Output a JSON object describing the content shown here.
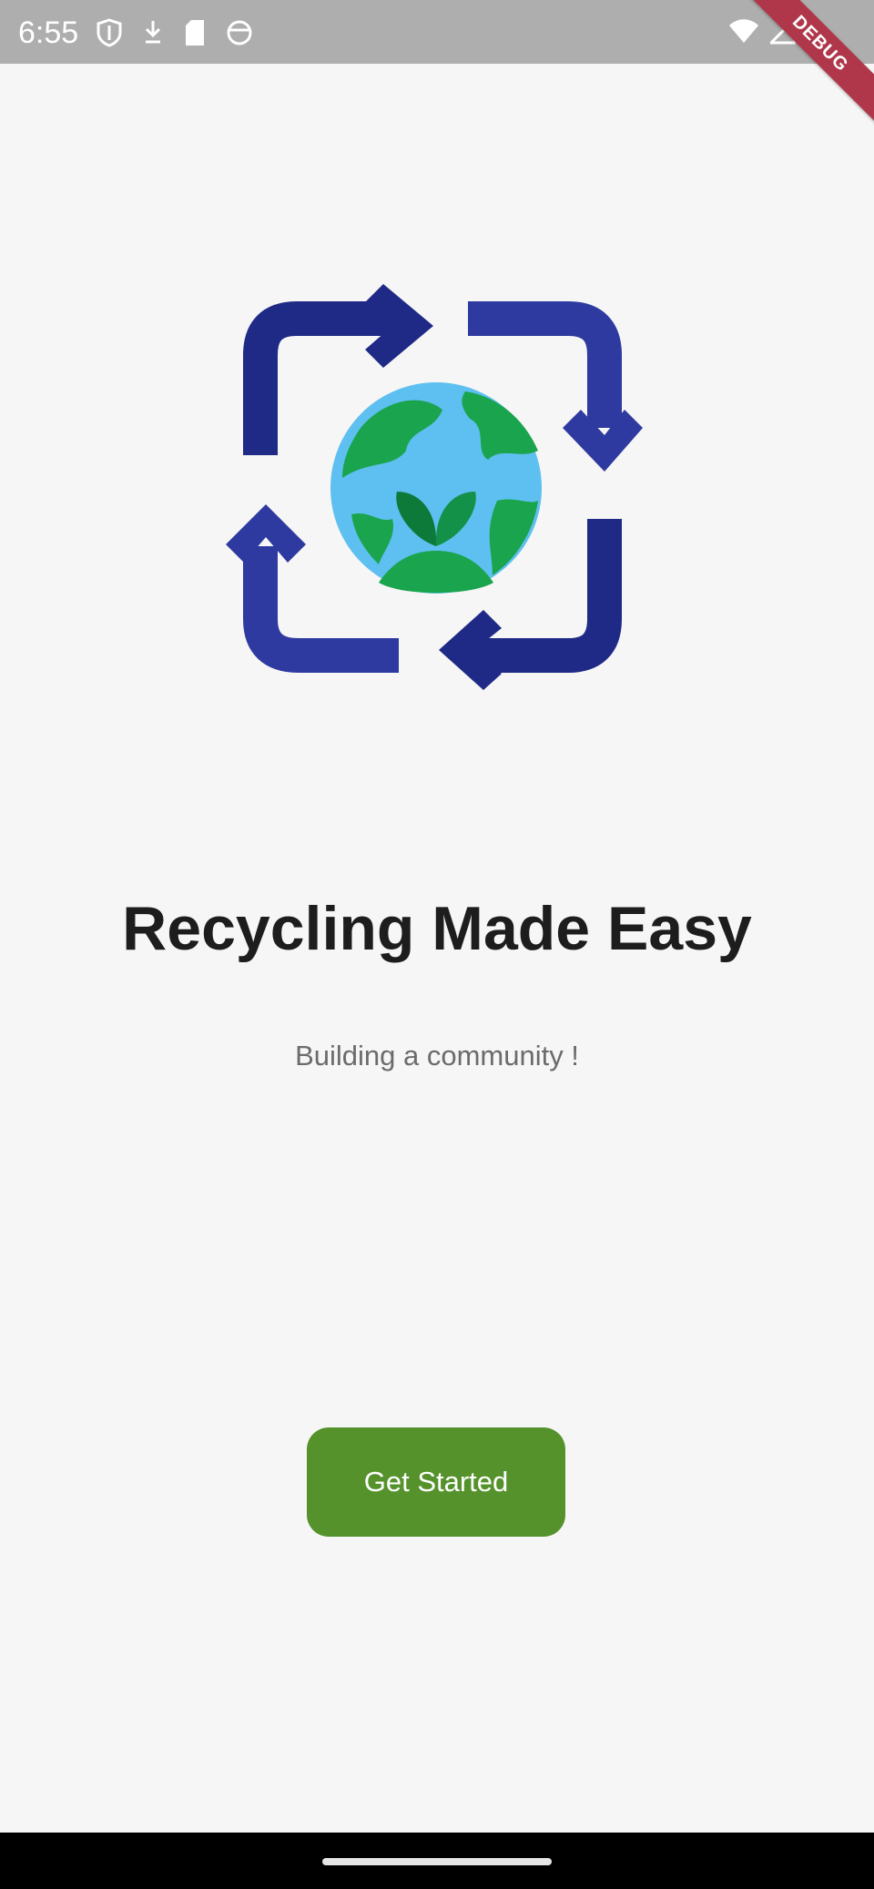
{
  "status_bar": {
    "time": "6:55",
    "icons_left": [
      "shield-icon",
      "download-icon",
      "sd-card-icon",
      "face-icon"
    ],
    "icons_right": [
      "wifi-icon",
      "signal-icon"
    ]
  },
  "debug_banner": {
    "label": "DEBUG",
    "color": "#b0374a"
  },
  "logo": {
    "icon": "recycle-globe-icon",
    "colors": {
      "arrows": "#283593",
      "globe_water": "#5ec0f0",
      "globe_land": "#1aa44e",
      "leaf": "#0e7a39"
    }
  },
  "hero": {
    "title": "Recycling Made Easy",
    "subtitle": "Building a community !"
  },
  "actions": {
    "get_started_label": "Get Started",
    "button_color": "#55922b"
  }
}
